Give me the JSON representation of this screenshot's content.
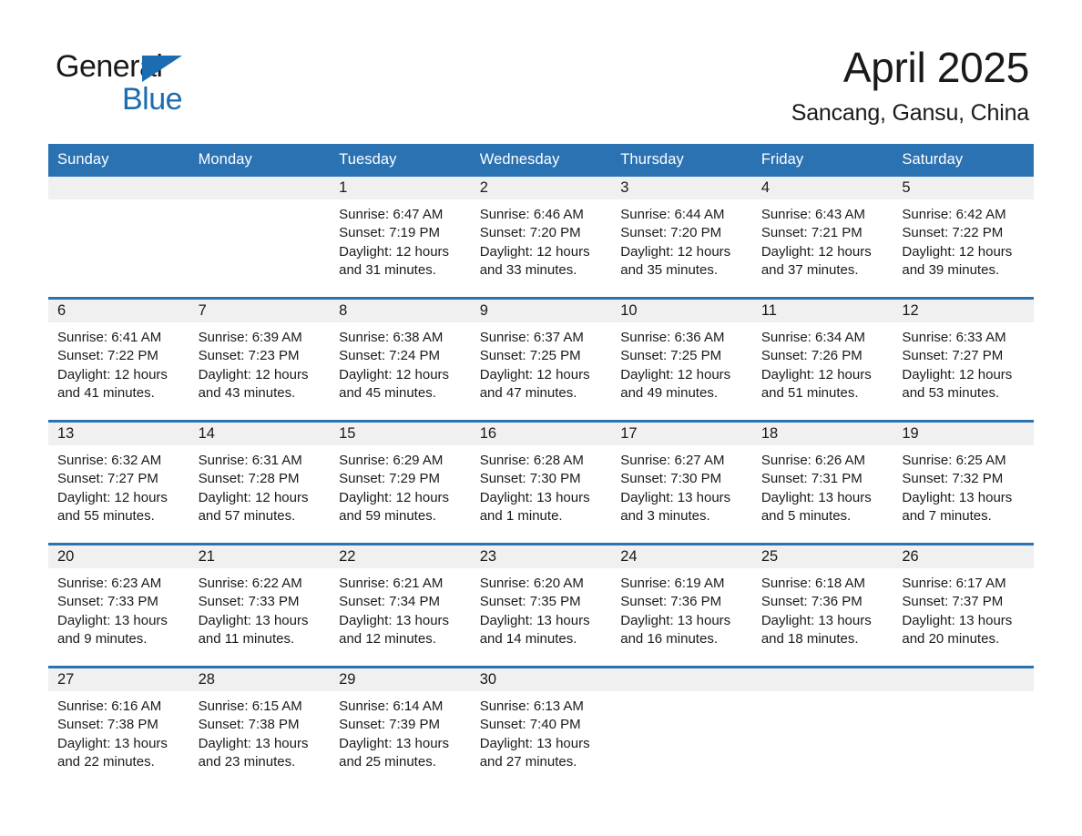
{
  "brand": {
    "name_part1": "General",
    "name_part2": "Blue",
    "triangle_icon": "brand-triangle-icon",
    "colors": {
      "blue": "#1b6cb0",
      "black": "#1a1a1a"
    }
  },
  "header": {
    "title": "April 2025",
    "subtitle": "Sancang, Gansu, China"
  },
  "theme": {
    "header_blue": "#2b72b3",
    "daynum_band_gray": "#f0f0f0",
    "page_background": "#ffffff",
    "text": "#1a1a1a"
  },
  "calendar": {
    "weekday_headers": [
      "Sunday",
      "Monday",
      "Tuesday",
      "Wednesday",
      "Thursday",
      "Friday",
      "Saturday"
    ],
    "weeks": [
      [
        {
          "day": "",
          "empty": true
        },
        {
          "day": "",
          "empty": true
        },
        {
          "day": "1",
          "sunrise": "Sunrise: 6:47 AM",
          "sunset": "Sunset: 7:19 PM",
          "daylight_line1": "Daylight: 12 hours",
          "daylight_line2": "and 31 minutes."
        },
        {
          "day": "2",
          "sunrise": "Sunrise: 6:46 AM",
          "sunset": "Sunset: 7:20 PM",
          "daylight_line1": "Daylight: 12 hours",
          "daylight_line2": "and 33 minutes."
        },
        {
          "day": "3",
          "sunrise": "Sunrise: 6:44 AM",
          "sunset": "Sunset: 7:20 PM",
          "daylight_line1": "Daylight: 12 hours",
          "daylight_line2": "and 35 minutes."
        },
        {
          "day": "4",
          "sunrise": "Sunrise: 6:43 AM",
          "sunset": "Sunset: 7:21 PM",
          "daylight_line1": "Daylight: 12 hours",
          "daylight_line2": "and 37 minutes."
        },
        {
          "day": "5",
          "sunrise": "Sunrise: 6:42 AM",
          "sunset": "Sunset: 7:22 PM",
          "daylight_line1": "Daylight: 12 hours",
          "daylight_line2": "and 39 minutes."
        }
      ],
      [
        {
          "day": "6",
          "sunrise": "Sunrise: 6:41 AM",
          "sunset": "Sunset: 7:22 PM",
          "daylight_line1": "Daylight: 12 hours",
          "daylight_line2": "and 41 minutes."
        },
        {
          "day": "7",
          "sunrise": "Sunrise: 6:39 AM",
          "sunset": "Sunset: 7:23 PM",
          "daylight_line1": "Daylight: 12 hours",
          "daylight_line2": "and 43 minutes."
        },
        {
          "day": "8",
          "sunrise": "Sunrise: 6:38 AM",
          "sunset": "Sunset: 7:24 PM",
          "daylight_line1": "Daylight: 12 hours",
          "daylight_line2": "and 45 minutes."
        },
        {
          "day": "9",
          "sunrise": "Sunrise: 6:37 AM",
          "sunset": "Sunset: 7:25 PM",
          "daylight_line1": "Daylight: 12 hours",
          "daylight_line2": "and 47 minutes."
        },
        {
          "day": "10",
          "sunrise": "Sunrise: 6:36 AM",
          "sunset": "Sunset: 7:25 PM",
          "daylight_line1": "Daylight: 12 hours",
          "daylight_line2": "and 49 minutes."
        },
        {
          "day": "11",
          "sunrise": "Sunrise: 6:34 AM",
          "sunset": "Sunset: 7:26 PM",
          "daylight_line1": "Daylight: 12 hours",
          "daylight_line2": "and 51 minutes."
        },
        {
          "day": "12",
          "sunrise": "Sunrise: 6:33 AM",
          "sunset": "Sunset: 7:27 PM",
          "daylight_line1": "Daylight: 12 hours",
          "daylight_line2": "and 53 minutes."
        }
      ],
      [
        {
          "day": "13",
          "sunrise": "Sunrise: 6:32 AM",
          "sunset": "Sunset: 7:27 PM",
          "daylight_line1": "Daylight: 12 hours",
          "daylight_line2": "and 55 minutes."
        },
        {
          "day": "14",
          "sunrise": "Sunrise: 6:31 AM",
          "sunset": "Sunset: 7:28 PM",
          "daylight_line1": "Daylight: 12 hours",
          "daylight_line2": "and 57 minutes."
        },
        {
          "day": "15",
          "sunrise": "Sunrise: 6:29 AM",
          "sunset": "Sunset: 7:29 PM",
          "daylight_line1": "Daylight: 12 hours",
          "daylight_line2": "and 59 minutes."
        },
        {
          "day": "16",
          "sunrise": "Sunrise: 6:28 AM",
          "sunset": "Sunset: 7:30 PM",
          "daylight_line1": "Daylight: 13 hours",
          "daylight_line2": "and 1 minute."
        },
        {
          "day": "17",
          "sunrise": "Sunrise: 6:27 AM",
          "sunset": "Sunset: 7:30 PM",
          "daylight_line1": "Daylight: 13 hours",
          "daylight_line2": "and 3 minutes."
        },
        {
          "day": "18",
          "sunrise": "Sunrise: 6:26 AM",
          "sunset": "Sunset: 7:31 PM",
          "daylight_line1": "Daylight: 13 hours",
          "daylight_line2": "and 5 minutes."
        },
        {
          "day": "19",
          "sunrise": "Sunrise: 6:25 AM",
          "sunset": "Sunset: 7:32 PM",
          "daylight_line1": "Daylight: 13 hours",
          "daylight_line2": "and 7 minutes."
        }
      ],
      [
        {
          "day": "20",
          "sunrise": "Sunrise: 6:23 AM",
          "sunset": "Sunset: 7:33 PM",
          "daylight_line1": "Daylight: 13 hours",
          "daylight_line2": "and 9 minutes."
        },
        {
          "day": "21",
          "sunrise": "Sunrise: 6:22 AM",
          "sunset": "Sunset: 7:33 PM",
          "daylight_line1": "Daylight: 13 hours",
          "daylight_line2": "and 11 minutes."
        },
        {
          "day": "22",
          "sunrise": "Sunrise: 6:21 AM",
          "sunset": "Sunset: 7:34 PM",
          "daylight_line1": "Daylight: 13 hours",
          "daylight_line2": "and 12 minutes."
        },
        {
          "day": "23",
          "sunrise": "Sunrise: 6:20 AM",
          "sunset": "Sunset: 7:35 PM",
          "daylight_line1": "Daylight: 13 hours",
          "daylight_line2": "and 14 minutes."
        },
        {
          "day": "24",
          "sunrise": "Sunrise: 6:19 AM",
          "sunset": "Sunset: 7:36 PM",
          "daylight_line1": "Daylight: 13 hours",
          "daylight_line2": "and 16 minutes."
        },
        {
          "day": "25",
          "sunrise": "Sunrise: 6:18 AM",
          "sunset": "Sunset: 7:36 PM",
          "daylight_line1": "Daylight: 13 hours",
          "daylight_line2": "and 18 minutes."
        },
        {
          "day": "26",
          "sunrise": "Sunrise: 6:17 AM",
          "sunset": "Sunset: 7:37 PM",
          "daylight_line1": "Daylight: 13 hours",
          "daylight_line2": "and 20 minutes."
        }
      ],
      [
        {
          "day": "27",
          "sunrise": "Sunrise: 6:16 AM",
          "sunset": "Sunset: 7:38 PM",
          "daylight_line1": "Daylight: 13 hours",
          "daylight_line2": "and 22 minutes."
        },
        {
          "day": "28",
          "sunrise": "Sunrise: 6:15 AM",
          "sunset": "Sunset: 7:38 PM",
          "daylight_line1": "Daylight: 13 hours",
          "daylight_line2": "and 23 minutes."
        },
        {
          "day": "29",
          "sunrise": "Sunrise: 6:14 AM",
          "sunset": "Sunset: 7:39 PM",
          "daylight_line1": "Daylight: 13 hours",
          "daylight_line2": "and 25 minutes."
        },
        {
          "day": "30",
          "sunrise": "Sunrise: 6:13 AM",
          "sunset": "Sunset: 7:40 PM",
          "daylight_line1": "Daylight: 13 hours",
          "daylight_line2": "and 27 minutes."
        },
        {
          "day": "",
          "empty": true
        },
        {
          "day": "",
          "empty": true
        },
        {
          "day": "",
          "empty": true
        }
      ]
    ]
  }
}
